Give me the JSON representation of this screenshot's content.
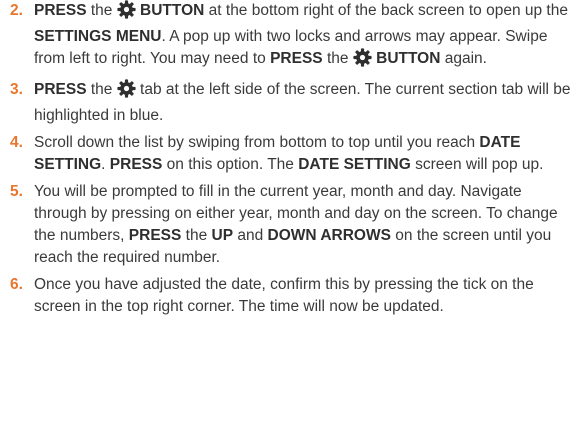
{
  "icon": {
    "name": "gear-icon",
    "color": "#2f2f2f"
  },
  "accent_color": "#e8772e",
  "steps": [
    {
      "number": "2.",
      "parts": [
        {
          "t": "PRESS",
          "b": true
        },
        {
          "t": " the "
        },
        {
          "icon": "gear"
        },
        {
          "t": " BUTTON",
          "b": true
        },
        {
          "t": " at the bottom right of the back screen to open up the "
        },
        {
          "t": "SETTINGS MENU",
          "b": true
        },
        {
          "t": ". A pop up with two locks and arrows may appear. Swipe from left to right. You may need to "
        },
        {
          "t": "PRESS",
          "b": true
        },
        {
          "t": " the "
        },
        {
          "icon": "gear"
        },
        {
          "t": " BUTTON",
          "b": true
        },
        {
          "t": " again."
        }
      ]
    },
    {
      "number": "3.",
      "parts": [
        {
          "t": "PRESS",
          "b": true
        },
        {
          "t": " the "
        },
        {
          "icon": "gear"
        },
        {
          "t": " tab at the left side of the screen. The current section tab will be highlighted in blue."
        }
      ]
    },
    {
      "number": "4.",
      "parts": [
        {
          "t": "Scroll down the list by swiping from bottom to top until you reach "
        },
        {
          "t": "DATE SETTING",
          "b": true
        },
        {
          "t": ". "
        },
        {
          "t": "PRESS",
          "b": true
        },
        {
          "t": " on this option. The "
        },
        {
          "t": "DATE SETTING",
          "b": true
        },
        {
          "t": " screen will pop up."
        }
      ]
    },
    {
      "number": "5.",
      "parts": [
        {
          "t": "You will be prompted to fill in the current year, month and day. Navigate through by pressing on either year, month and day on the screen. To change the numbers, "
        },
        {
          "t": "PRESS",
          "b": true
        },
        {
          "t": " the "
        },
        {
          "t": "UP",
          "b": true
        },
        {
          "t": " and "
        },
        {
          "t": "DOWN ARROWS",
          "b": true
        },
        {
          "t": " on the screen until you reach the required number."
        }
      ]
    },
    {
      "number": "6.",
      "parts": [
        {
          "t": "Once you have adjusted the date, confirm this by pressing the tick on the screen in the top right corner. The time will now be updated."
        }
      ]
    }
  ]
}
